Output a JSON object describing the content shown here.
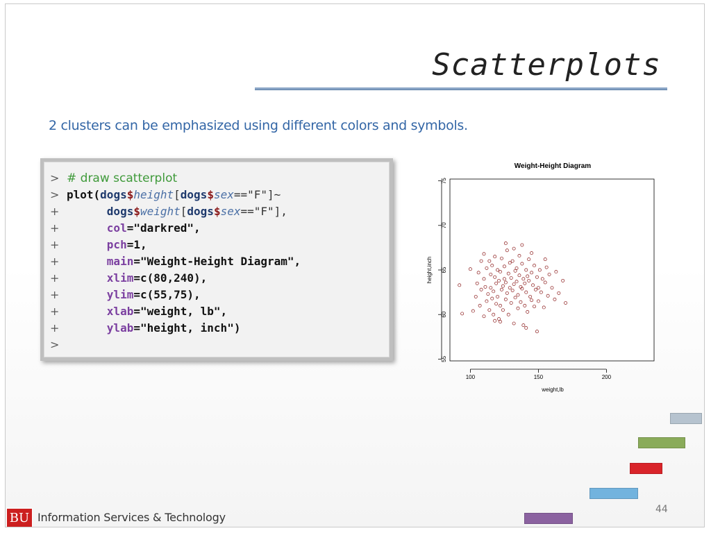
{
  "slide": {
    "title": "Scatterplots",
    "subtitle": "2 clusters can be emphasized using different colors and symbols.",
    "page_number": "44",
    "footer": {
      "logo_text": "BU",
      "org_name": "Information Services & Technology"
    }
  },
  "code": {
    "prompts": {
      "start": ">",
      "continue": "+"
    },
    "comment": "# draw scatterplot",
    "plot_call": "plot(",
    "dogs": "dogs",
    "dollar": "$",
    "height_field": "height",
    "sex_field": "sex",
    "weight_field": "weight",
    "bracket_open": "[",
    "eq_f_close_tilde": "==\"F\"]~",
    "eq_f_close_comma": "==\"F\"],",
    "args": [
      {
        "name": "col",
        "value": "=\"darkred\","
      },
      {
        "name": "pch",
        "value": "=1,"
      },
      {
        "name": "main",
        "value": "=\"Weight-Height Diagram\","
      },
      {
        "name": "xlim",
        "value": "=c(80,240),"
      },
      {
        "name": "ylim",
        "value": "=c(55,75),"
      },
      {
        "name": "xlab",
        "value": "=\"weight, lb\","
      },
      {
        "name": "ylab",
        "value": "=\"height, inch\")"
      }
    ]
  },
  "chart_data": {
    "type": "scatter",
    "title": "Weight-Height Diagram",
    "xlabel": "weight,lb",
    "ylabel": "height,inch",
    "xlim": [
      80,
      240
    ],
    "ylim": [
      55,
      75
    ],
    "xticks": [
      "100",
      "150",
      "200"
    ],
    "yticks": [
      "55",
      "60",
      "65",
      "70",
      "75"
    ],
    "grid": false,
    "point_color": "#8b1a1a",
    "marker": "open-circle",
    "series": [
      {
        "points": [
          [
            92,
            63.3
          ],
          [
            94,
            60.1
          ],
          [
            100,
            65.1
          ],
          [
            102,
            60.4
          ],
          [
            104,
            62.0
          ],
          [
            105,
            63.5
          ],
          [
            106,
            64.7
          ],
          [
            107,
            61.0
          ],
          [
            108,
            66.0
          ],
          [
            108,
            62.8
          ],
          [
            110,
            64.0
          ],
          [
            110,
            59.8
          ],
          [
            111,
            63.1
          ],
          [
            112,
            65.2
          ],
          [
            112,
            61.5
          ],
          [
            113,
            62.3
          ],
          [
            114,
            66.0
          ],
          [
            114,
            60.5
          ],
          [
            115,
            64.5
          ],
          [
            115,
            63.0
          ],
          [
            116,
            61.8
          ],
          [
            116,
            65.5
          ],
          [
            117,
            62.6
          ],
          [
            117,
            60.0
          ],
          [
            118,
            64.2
          ],
          [
            118,
            66.5
          ],
          [
            119,
            63.5
          ],
          [
            119,
            61.2
          ],
          [
            120,
            65.0
          ],
          [
            120,
            62.0
          ],
          [
            121,
            63.8
          ],
          [
            121,
            59.5
          ],
          [
            122,
            64.8
          ],
          [
            122,
            61.0
          ],
          [
            123,
            66.3
          ],
          [
            123,
            62.8
          ],
          [
            124,
            63.2
          ],
          [
            124,
            60.5
          ],
          [
            125,
            65.4
          ],
          [
            125,
            64.0
          ],
          [
            126,
            61.7
          ],
          [
            126,
            63.6
          ],
          [
            127,
            67.2
          ],
          [
            127,
            62.4
          ],
          [
            128,
            64.6
          ],
          [
            128,
            60.0
          ],
          [
            129,
            63.0
          ],
          [
            129,
            65.8
          ],
          [
            130,
            61.3
          ],
          [
            130,
            64.1
          ],
          [
            131,
            62.7
          ],
          [
            131,
            66.0
          ],
          [
            132,
            63.4
          ],
          [
            132,
            59.0
          ],
          [
            133,
            64.9
          ],
          [
            133,
            61.9
          ],
          [
            134,
            63.7
          ],
          [
            134,
            65.2
          ],
          [
            135,
            62.2
          ],
          [
            135,
            60.7
          ],
          [
            136,
            64.4
          ],
          [
            136,
            66.6
          ],
          [
            137,
            63.1
          ],
          [
            137,
            61.4
          ],
          [
            138,
            65.7
          ],
          [
            138,
            62.9
          ],
          [
            139,
            64.0
          ],
          [
            139,
            58.8
          ],
          [
            140,
            63.5
          ],
          [
            140,
            61.0
          ],
          [
            141,
            65.0
          ],
          [
            141,
            62.5
          ],
          [
            142,
            64.3
          ],
          [
            142,
            60.3
          ],
          [
            143,
            63.8
          ],
          [
            143,
            66.2
          ],
          [
            144,
            62.0
          ],
          [
            145,
            64.7
          ],
          [
            145,
            61.6
          ],
          [
            146,
            63.3
          ],
          [
            147,
            65.5
          ],
          [
            147,
            60.9
          ],
          [
            148,
            62.8
          ],
          [
            149,
            64.2
          ],
          [
            150,
            63.0
          ],
          [
            150,
            61.5
          ],
          [
            151,
            65.0
          ],
          [
            152,
            62.5
          ],
          [
            153,
            64.0
          ],
          [
            154,
            60.8
          ],
          [
            155,
            63.6
          ],
          [
            156,
            65.3
          ],
          [
            157,
            62.1
          ],
          [
            158,
            64.5
          ],
          [
            160,
            63.0
          ],
          [
            162,
            61.7
          ],
          [
            163,
            64.8
          ],
          [
            165,
            62.4
          ],
          [
            168,
            63.8
          ],
          [
            170,
            61.3
          ],
          [
            126,
            68.0
          ],
          [
            132,
            67.4
          ],
          [
            118,
            59.3
          ],
          [
            141,
            58.5
          ],
          [
            149,
            58.1
          ],
          [
            110,
            66.8
          ],
          [
            138,
            67.8
          ],
          [
            122,
            59.2
          ],
          [
            145,
            66.9
          ],
          [
            155,
            66.2
          ]
        ]
      }
    ]
  },
  "deco_colors": [
    "#b6c3cf",
    "#8aab5a",
    "#d9242a",
    "#72b3de",
    "#8b62a0"
  ]
}
